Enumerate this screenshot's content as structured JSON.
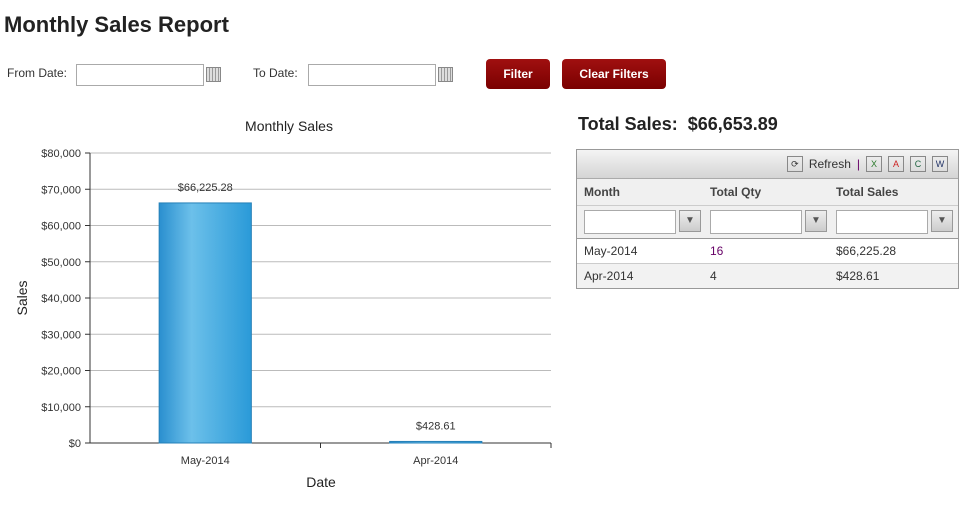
{
  "page_title": "Monthly Sales Report",
  "filters": {
    "from_label": "From Date:",
    "from_value": "",
    "to_label": "To Date:",
    "to_value": "",
    "filter_button": "Filter",
    "clear_button": "Clear Filters",
    "accent": "#8b0000"
  },
  "summary": {
    "label": "Total Sales:",
    "value": "$66,653.89"
  },
  "grid": {
    "refresh_label": "Refresh",
    "separator": "|",
    "export_icons": [
      "excel-export-icon",
      "pdf-export-icon",
      "csv-export-icon",
      "word-export-icon"
    ],
    "columns": [
      "Month",
      "Total Qty",
      "Total Sales"
    ],
    "rows": [
      [
        "May-2014",
        "16",
        "$66,225.28"
      ],
      [
        "Apr-2014",
        "4",
        "$428.61"
      ]
    ]
  },
  "chart_data": {
    "type": "bar",
    "title": "Monthly Sales",
    "xlabel": "Date",
    "ylabel": "Sales",
    "categories": [
      "May-2014",
      "Apr-2014"
    ],
    "values": [
      66225.28,
      428.61
    ],
    "data_labels": [
      "$66,225.28",
      "$428.61"
    ],
    "ylim": [
      0,
      80000
    ],
    "yticks": [
      "$0",
      "$10,000",
      "$20,000",
      "$30,000",
      "$40,000",
      "$50,000",
      "$60,000",
      "$70,000",
      "$80,000"
    ],
    "grid": true,
    "bar_color": "#3aa3dc"
  }
}
